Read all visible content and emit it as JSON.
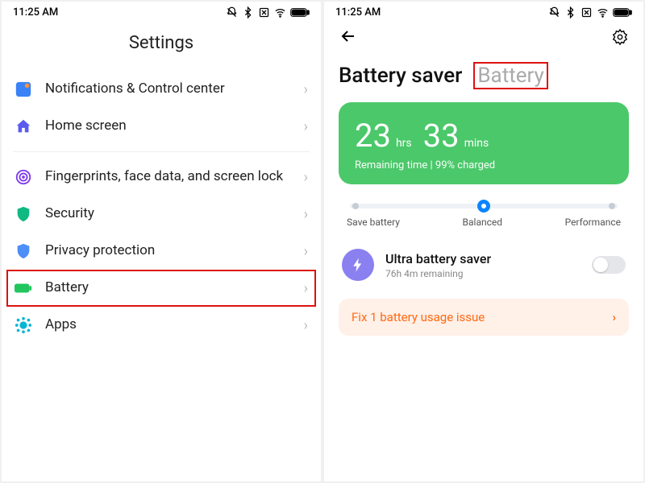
{
  "status": {
    "time": "11:25 AM"
  },
  "left": {
    "title": "Settings",
    "items": [
      {
        "label": "Notifications & Control center"
      },
      {
        "label": "Home screen"
      },
      {
        "label": "Fingerprints, face data, and screen lock"
      },
      {
        "label": "Security"
      },
      {
        "label": "Privacy protection"
      },
      {
        "label": "Battery"
      },
      {
        "label": "Apps"
      }
    ]
  },
  "right": {
    "tabs": {
      "active": "Battery saver",
      "inactive": "Battery"
    },
    "card": {
      "hours": "23",
      "hrs_unit": "hrs",
      "mins": "33",
      "mins_unit": "mins",
      "sub": "Remaining time | 99% charged"
    },
    "modes": {
      "a": "Save battery",
      "b": "Balanced",
      "c": "Performance"
    },
    "ultra": {
      "title": "Ultra battery saver",
      "sub": "76h 4m remaining"
    },
    "warn": "Fix 1 battery usage issue"
  }
}
